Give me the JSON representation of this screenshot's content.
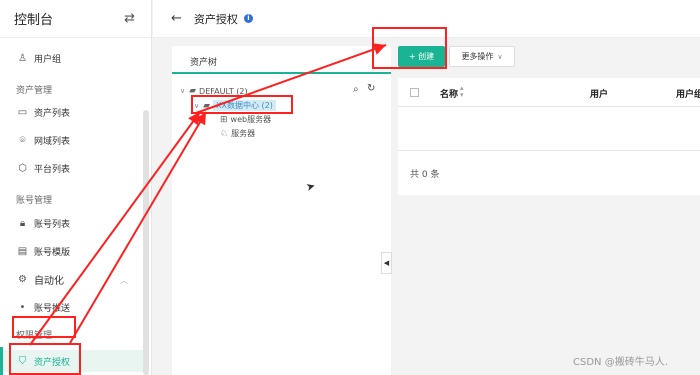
{
  "sidebar": {
    "title": "控制台",
    "toggle_icon": "swap-icon",
    "items": [
      {
        "label": "用户组",
        "icon": "user-group-icon"
      },
      {
        "label": "资产列表",
        "icon": "monitor-icon"
      },
      {
        "label": "网域列表",
        "icon": "location-icon"
      },
      {
        "label": "平台列表",
        "icon": "cube-icon"
      },
      {
        "label": "账号列表",
        "icon": "lock-icon"
      },
      {
        "label": "账号模版",
        "icon": "template-icon"
      },
      {
        "label": "自动化",
        "icon": "automation-icon"
      },
      {
        "label": "账号推送",
        "icon": "dot-icon"
      },
      {
        "label": "资产授权",
        "icon": "shield-icon"
      }
    ],
    "groups": [
      "资产管理",
      "账号管理",
      "权限管理"
    ]
  },
  "header": {
    "title": "资产授权"
  },
  "tree": {
    "tab_label": "资产树",
    "root": "DEFAULT (2)",
    "child": "XX数据中心 (2)",
    "leaves": [
      "web服务器",
      "服务器"
    ]
  },
  "toolbar": {
    "create_label": "+ 创建",
    "more_label": "更多操作"
  },
  "table": {
    "columns": [
      "名称",
      "用户",
      "用户组"
    ],
    "total": "共 0 条"
  },
  "watermark": "CSDN @搬砖牛马人.",
  "colors": {
    "accent": "#1ab394",
    "annotation": "#ff2020"
  }
}
